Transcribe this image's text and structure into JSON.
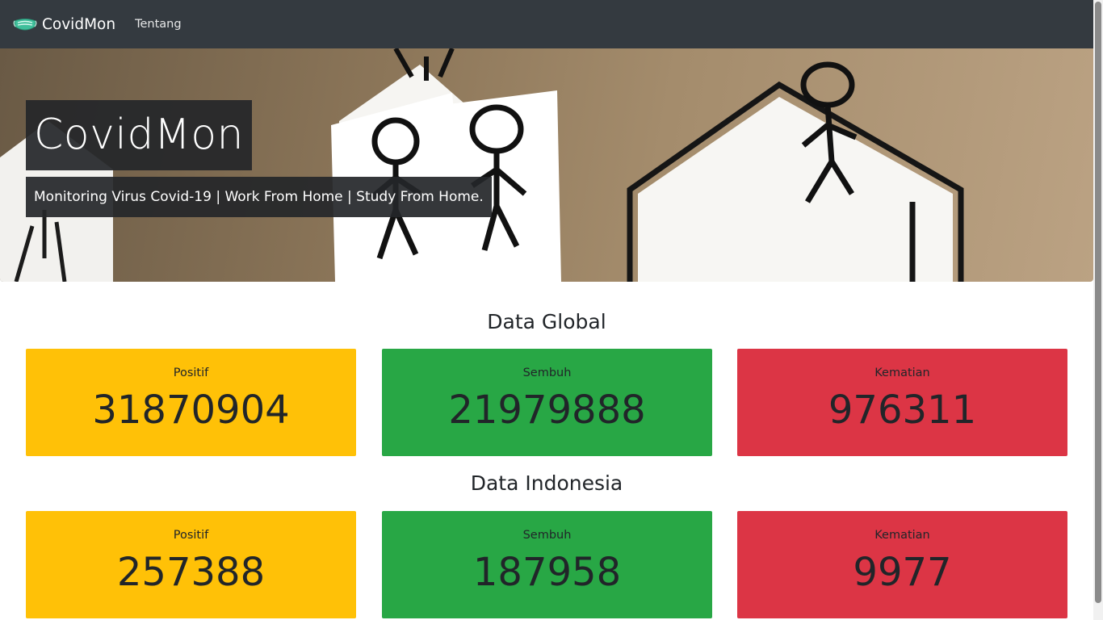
{
  "navbar": {
    "brand": "CovidMon",
    "links": [
      {
        "label": "Tentang"
      }
    ]
  },
  "hero": {
    "title": "CovidMon",
    "subtitle": "Monitoring Virus Covid-19 | Work From Home | Study From Home."
  },
  "global": {
    "title": "Data Global",
    "cards": [
      {
        "label": "Positif",
        "value": "31870904",
        "color": "#ffc107"
      },
      {
        "label": "Sembuh",
        "value": "21979888",
        "color": "#28a745"
      },
      {
        "label": "Kematian",
        "value": "976311",
        "color": "#dc3545"
      }
    ]
  },
  "indonesia": {
    "title": "Data Indonesia",
    "cards": [
      {
        "label": "Positif",
        "value": "257388",
        "color": "#ffc107"
      },
      {
        "label": "Sembuh",
        "value": "187958",
        "color": "#28a745"
      },
      {
        "label": "Kematian",
        "value": "9977",
        "color": "#dc3545"
      }
    ]
  },
  "icons": {
    "brand": "face-mask-icon"
  }
}
